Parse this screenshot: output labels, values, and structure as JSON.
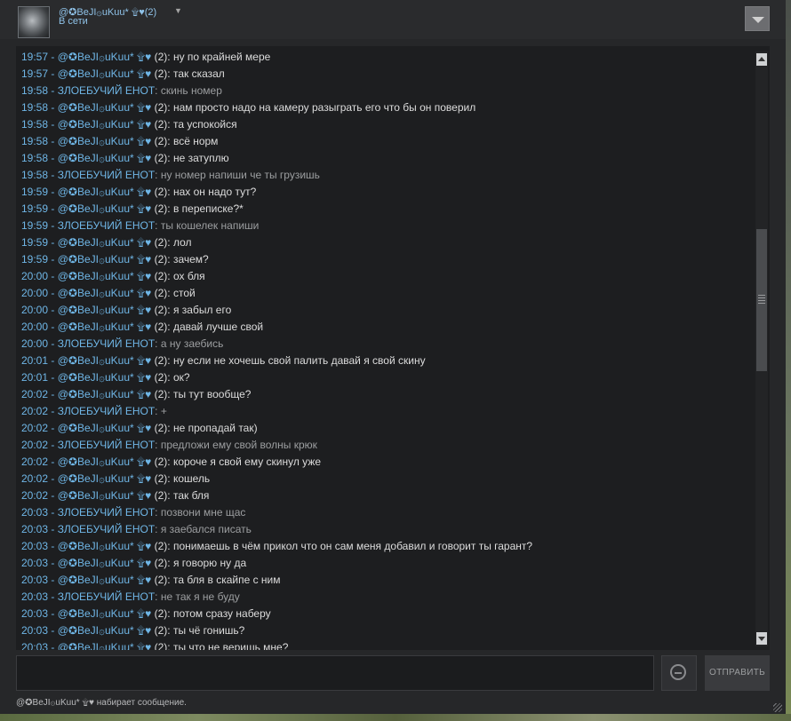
{
  "header": {
    "user_name": "@✪BeJI۞uKuu* ۩♥(2)",
    "status": "В сети"
  },
  "messages": [
    {
      "time": "19:57",
      "author": "@✪BeJI۞uKuu* ۩♥",
      "suffix": "(2)",
      "text": "ну по крайней мере",
      "self": true
    },
    {
      "time": "19:57",
      "author": "@✪BeJI۞uKuu* ۩♥",
      "suffix": "(2)",
      "text": "так сказал",
      "self": true
    },
    {
      "time": "19:58",
      "author": "ЗЛОЕБУЧИЙ ЕНОТ",
      "suffix": "",
      "text": "скинь номер",
      "self": false
    },
    {
      "time": "19:58",
      "author": "@✪BeJI۞uKuu* ۩♥",
      "suffix": "(2)",
      "text": "нам просто надо на камеру разыграть его что бы он поверил",
      "self": true
    },
    {
      "time": "19:58",
      "author": "@✪BeJI۞uKuu* ۩♥",
      "suffix": "(2)",
      "text": "та успокойся",
      "self": true
    },
    {
      "time": "19:58",
      "author": "@✪BeJI۞uKuu* ۩♥",
      "suffix": "(2)",
      "text": "всё норм",
      "self": true
    },
    {
      "time": "19:58",
      "author": "@✪BeJI۞uKuu* ۩♥",
      "suffix": "(2)",
      "text": "не затуплю",
      "self": true
    },
    {
      "time": "19:58",
      "author": "ЗЛОЕБУЧИЙ ЕНОТ",
      "suffix": "",
      "text": "ну номер напиши че ты грузишь",
      "self": false
    },
    {
      "time": "19:59",
      "author": "@✪BeJI۞uKuu* ۩♥",
      "suffix": "(2)",
      "text": "нах он надо тут?",
      "self": true
    },
    {
      "time": "19:59",
      "author": "@✪BeJI۞uKuu* ۩♥",
      "suffix": "(2)",
      "text": "в переписке?*",
      "self": true
    },
    {
      "time": "19:59",
      "author": "ЗЛОЕБУЧИЙ ЕНОТ",
      "suffix": "",
      "text": "ты кошелек напиши",
      "self": false
    },
    {
      "time": "19:59",
      "author": "@✪BeJI۞uKuu* ۩♥",
      "suffix": "(2)",
      "text": "лол",
      "self": true
    },
    {
      "time": "19:59",
      "author": "@✪BeJI۞uKuu* ۩♥",
      "suffix": "(2)",
      "text": "зачем?",
      "self": true
    },
    {
      "time": "20:00",
      "author": "@✪BeJI۞uKuu* ۩♥",
      "suffix": "(2)",
      "text": "ох бля",
      "self": true
    },
    {
      "time": "20:00",
      "author": "@✪BeJI۞uKuu* ۩♥",
      "suffix": "(2)",
      "text": "стой",
      "self": true
    },
    {
      "time": "20:00",
      "author": "@✪BeJI۞uKuu* ۩♥",
      "suffix": "(2)",
      "text": "я забыл его",
      "self": true
    },
    {
      "time": "20:00",
      "author": "@✪BeJI۞uKuu* ۩♥",
      "suffix": "(2)",
      "text": "давай лучше свой",
      "self": true
    },
    {
      "time": "20:00",
      "author": "ЗЛОЕБУЧИЙ ЕНОТ",
      "suffix": "",
      "text": "а ну заебись",
      "self": false
    },
    {
      "time": "20:01",
      "author": "@✪BeJI۞uKuu* ۩♥",
      "suffix": "(2)",
      "text": "ну если не хочешь свой палить давай я свой скину",
      "self": true
    },
    {
      "time": "20:01",
      "author": "@✪BeJI۞uKuu* ۩♥",
      "suffix": "(2)",
      "text": "ок?",
      "self": true
    },
    {
      "time": "20:02",
      "author": "@✪BeJI۞uKuu* ۩♥",
      "suffix": "(2)",
      "text": "ты тут вообще?",
      "self": true
    },
    {
      "time": "20:02",
      "author": "ЗЛОЕБУЧИЙ ЕНОТ",
      "suffix": "",
      "text": "+",
      "self": false
    },
    {
      "time": "20:02",
      "author": "@✪BeJI۞uKuu* ۩♥",
      "suffix": "(2)",
      "text": "не пропадай так)",
      "self": true
    },
    {
      "time": "20:02",
      "author": "ЗЛОЕБУЧИЙ ЕНОТ",
      "suffix": "",
      "text": "предложи ему свой волны крюк",
      "self": false
    },
    {
      "time": "20:02",
      "author": "@✪BeJI۞uKuu* ۩♥",
      "suffix": "(2)",
      "text": "короче я свой ему скинул уже",
      "self": true
    },
    {
      "time": "20:02",
      "author": "@✪BeJI۞uKuu* ۩♥",
      "suffix": "(2)",
      "text": "кошель",
      "self": true
    },
    {
      "time": "20:02",
      "author": "@✪BeJI۞uKuu* ۩♥",
      "suffix": "(2)",
      "text": "так бля",
      "self": true
    },
    {
      "time": "20:03",
      "author": "ЗЛОЕБУЧИЙ ЕНОТ",
      "suffix": "",
      "text": "позвони мне щас",
      "self": false
    },
    {
      "time": "20:03",
      "author": "ЗЛОЕБУЧИЙ ЕНОТ",
      "suffix": "",
      "text": "я заебался писать",
      "self": false
    },
    {
      "time": "20:03",
      "author": "@✪BeJI۞uKuu* ۩♥",
      "suffix": "(2)",
      "text": "понимаешь в чём прикол что он сам меня добавил и говорит ты гарант?",
      "self": true
    },
    {
      "time": "20:03",
      "author": "@✪BeJI۞uKuu* ۩♥",
      "suffix": "(2)",
      "text": "я говорю ну да",
      "self": true
    },
    {
      "time": "20:03",
      "author": "@✪BeJI۞uKuu* ۩♥",
      "suffix": "(2)",
      "text": "та бля в скайпе с ним",
      "self": true
    },
    {
      "time": "20:03",
      "author": "ЗЛОЕБУЧИЙ ЕНОТ",
      "suffix": "",
      "text": "не так я не буду",
      "self": false
    },
    {
      "time": "20:03",
      "author": "@✪BeJI۞uKuu* ۩♥",
      "suffix": "(2)",
      "text": "потом сразу наберу",
      "self": true
    },
    {
      "time": "20:03",
      "author": "@✪BeJI۞uKuu* ۩♥",
      "suffix": "(2)",
      "text": "ты чё гонишь?",
      "self": true
    },
    {
      "time": "20:03",
      "author": "@✪BeJI۞uKuu* ۩♥",
      "suffix": "(2)",
      "text": "ты что не веришь мне?",
      "self": true
    }
  ],
  "composer": {
    "input_value": "",
    "send_label": "ОТПРАВИТЬ",
    "emoji_icon": "smiley-icon"
  },
  "typing_status": "@✪BeJI۞uKuu* ۩♥  набирает сообщение."
}
